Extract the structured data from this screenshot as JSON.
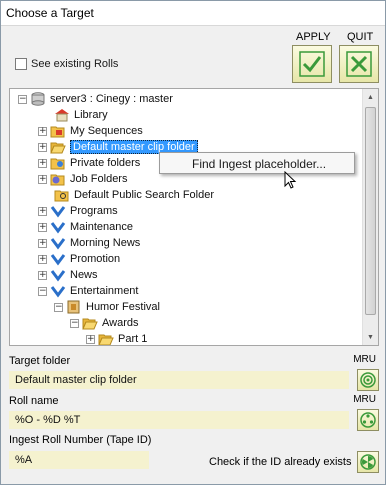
{
  "window": {
    "title": "Choose a Target"
  },
  "header": {
    "apply_label": "APPLY",
    "quit_label": "QUIT",
    "see_existing_label": "See existing Rolls"
  },
  "tree": {
    "root": "server3 : Cinegy : master",
    "items": [
      {
        "label": "Library"
      },
      {
        "label": "My Sequences"
      },
      {
        "label": "Default master clip folder",
        "selected": true
      },
      {
        "label": "Private folders"
      },
      {
        "label": "Job Folders"
      },
      {
        "label": "Default Public Search Folder"
      },
      {
        "label": "Programs"
      },
      {
        "label": "Maintenance"
      },
      {
        "label": "Morning News"
      },
      {
        "label": "Promotion"
      },
      {
        "label": "News"
      },
      {
        "label": "Entertainment"
      },
      {
        "label": "Humor Festival"
      },
      {
        "label": "Awards"
      },
      {
        "label": "Part 1"
      }
    ]
  },
  "context_menu": {
    "items": [
      "Find Ingest placeholder..."
    ]
  },
  "form": {
    "target_folder_label": "Target folder",
    "target_folder_value": "Default master clip folder",
    "roll_name_label": "Roll name",
    "roll_name_value": "%O - %D %T",
    "ingest_label": "Ingest Roll Number (Tape ID)",
    "ingest_value": "%A",
    "mru_label": "MRU",
    "check_id_label": "Check if the ID already exists"
  },
  "colors": {
    "selection": "#3399ff",
    "field_bg": "#f5f2cf",
    "check_green": "#3a9a3a"
  }
}
